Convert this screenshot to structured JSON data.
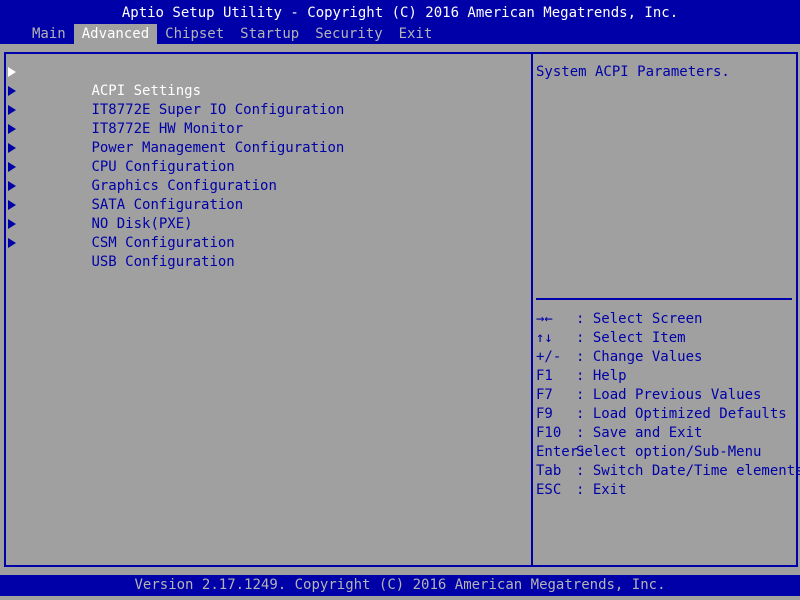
{
  "header": {
    "title": "Aptio Setup Utility - Copyright (C) 2016 American Megatrends, Inc."
  },
  "tabs": [
    {
      "label": "Main"
    },
    {
      "label": "Advanced"
    },
    {
      "label": "Chipset"
    },
    {
      "label": "Startup"
    },
    {
      "label": "Security"
    },
    {
      "label": "Exit"
    }
  ],
  "menu": {
    "items": [
      {
        "label": "ACPI Settings"
      },
      {
        "label": "IT8772E Super IO Configuration"
      },
      {
        "label": "IT8772E HW Monitor"
      },
      {
        "label": "Power Management Configuration"
      },
      {
        "label": "CPU Configuration"
      },
      {
        "label": "Graphics Configuration"
      },
      {
        "label": "SATA Configuration"
      },
      {
        "label": "NO Disk(PXE)"
      },
      {
        "label": "CSM Configuration"
      },
      {
        "label": "USB Configuration"
      }
    ]
  },
  "help": {
    "text": "System ACPI Parameters."
  },
  "keys": [
    {
      "key": "→←",
      "desc": ": Select Screen"
    },
    {
      "key": "↑↓",
      "desc": ": Select Item"
    },
    {
      "key": "+/-",
      "desc": ": Change Values"
    },
    {
      "key": "F1",
      "desc": ": Help"
    },
    {
      "key": "F7",
      "desc": ": Load Previous Values"
    },
    {
      "key": "F9",
      "desc": ": Load Optimized Defaults"
    },
    {
      "key": "F10",
      "desc": ": Save and Exit"
    },
    {
      "key": "Enter:",
      "desc": "Select option/Sub-Menu"
    },
    {
      "key": "Tab",
      "desc": ": Switch Date/Time elements"
    },
    {
      "key": "ESC",
      "desc": ": Exit"
    }
  ],
  "footer": {
    "version": "Version 2.17.1249. Copyright (C) 2016 American Megatrends, Inc."
  },
  "colors": {
    "bar_blue": "#0000a8",
    "panel_gray": "#a0a0a0",
    "text_white": "#ffffff",
    "text_dim": "#b4b4b4"
  }
}
